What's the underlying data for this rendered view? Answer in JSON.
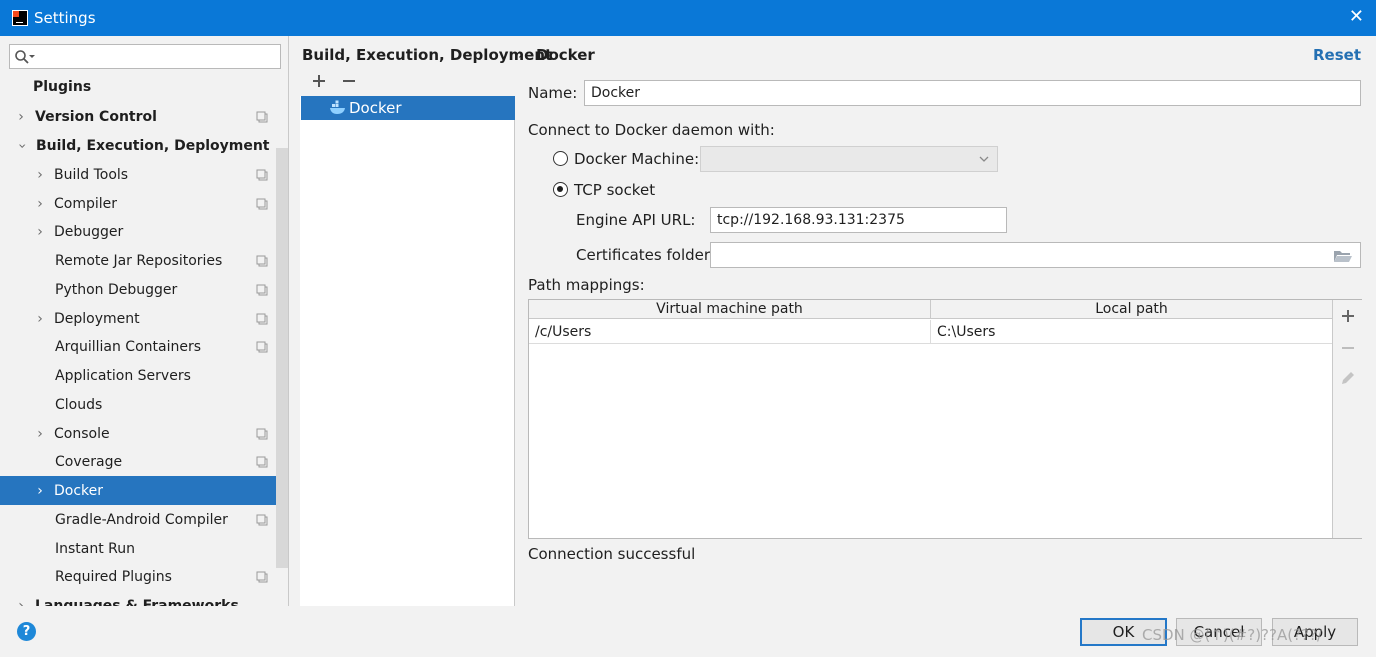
{
  "window": {
    "title": "Settings",
    "close_label": "✕"
  },
  "search": {
    "placeholder": ""
  },
  "sidebar": {
    "items": [
      {
        "label": "Plugins"
      },
      {
        "label": "Version Control"
      },
      {
        "label": "Build, Execution, Deployment"
      },
      {
        "label": "Build Tools"
      },
      {
        "label": "Compiler"
      },
      {
        "label": "Debugger"
      },
      {
        "label": "Remote Jar Repositories"
      },
      {
        "label": "Python Debugger"
      },
      {
        "label": "Deployment"
      },
      {
        "label": "Arquillian Containers"
      },
      {
        "label": "Application Servers"
      },
      {
        "label": "Clouds"
      },
      {
        "label": "Console"
      },
      {
        "label": "Coverage"
      },
      {
        "label": "Docker"
      },
      {
        "label": "Gradle-Android Compiler"
      },
      {
        "label": "Instant Run"
      },
      {
        "label": "Required Plugins"
      },
      {
        "label": "Languages & Frameworks"
      }
    ]
  },
  "breadcrumb": {
    "parent": "Build, Execution, Deployment",
    "separator": "›",
    "current": "Docker"
  },
  "reset_label": "Reset",
  "docker_list": {
    "add": "+",
    "remove": "−",
    "entries": [
      "Docker"
    ]
  },
  "form": {
    "name_label": "Name:",
    "name_value": "Docker",
    "connect_label": "Connect to Docker daemon with:",
    "docker_machine_label": "Docker Machine:",
    "tcp_socket_label": "TCP socket",
    "engine_api_label": "Engine API URL:",
    "engine_api_value": "tcp://192.168.93.131:2375",
    "certificates_label": "Certificates folder:",
    "certificates_value": "",
    "path_mappings_label": "Path mappings:"
  },
  "path_table": {
    "headers": [
      "Virtual machine path",
      "Local path"
    ],
    "rows": [
      [
        "/c/Users",
        "C:\\Users"
      ]
    ]
  },
  "status": "Connection successful",
  "footer": {
    "help": "?",
    "ok": "OK",
    "cancel": "Cancel",
    "apply": "Apply",
    "watermark": "CSDN @(↑)(#?)??A(???/"
  }
}
